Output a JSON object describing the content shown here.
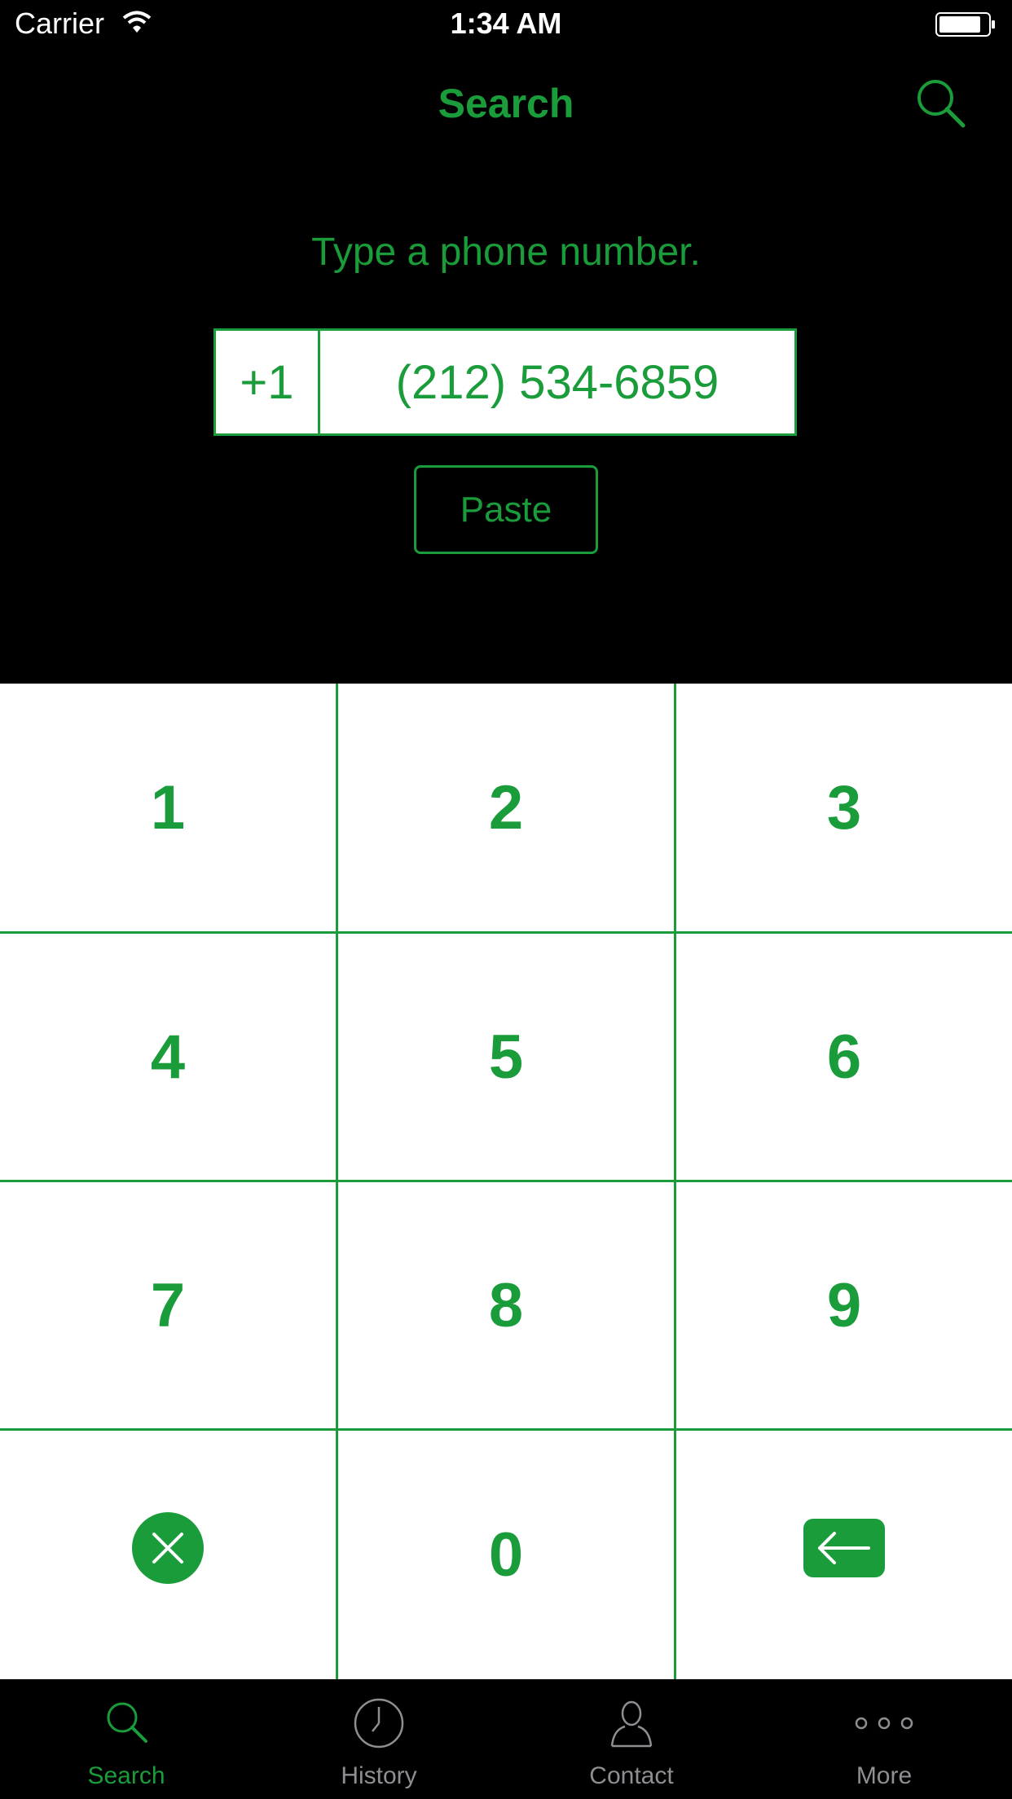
{
  "status_bar": {
    "carrier": "Carrier",
    "time": "1:34 AM"
  },
  "nav": {
    "title": "Search"
  },
  "prompt": "Type a phone number.",
  "phone_field": {
    "country_code": "+1",
    "number": "(212) 534-6859"
  },
  "paste_label": "Paste",
  "keypad": {
    "keys": [
      "1",
      "2",
      "3",
      "4",
      "5",
      "6",
      "7",
      "8",
      "9",
      "0"
    ],
    "clear_icon": "clear-x-icon",
    "backspace_icon": "backspace-arrow-icon"
  },
  "tabs": [
    {
      "label": "Search",
      "icon": "search-icon",
      "active": true
    },
    {
      "label": "History",
      "icon": "clock-icon",
      "active": false
    },
    {
      "label": "Contact",
      "icon": "person-icon",
      "active": false
    },
    {
      "label": "More",
      "icon": "more-dots-icon",
      "active": false
    }
  ],
  "colors": {
    "accent": "#1a9c3b",
    "background": "#000000",
    "keypad_background": "#ffffff",
    "inactive_tab": "#8e8e93"
  }
}
